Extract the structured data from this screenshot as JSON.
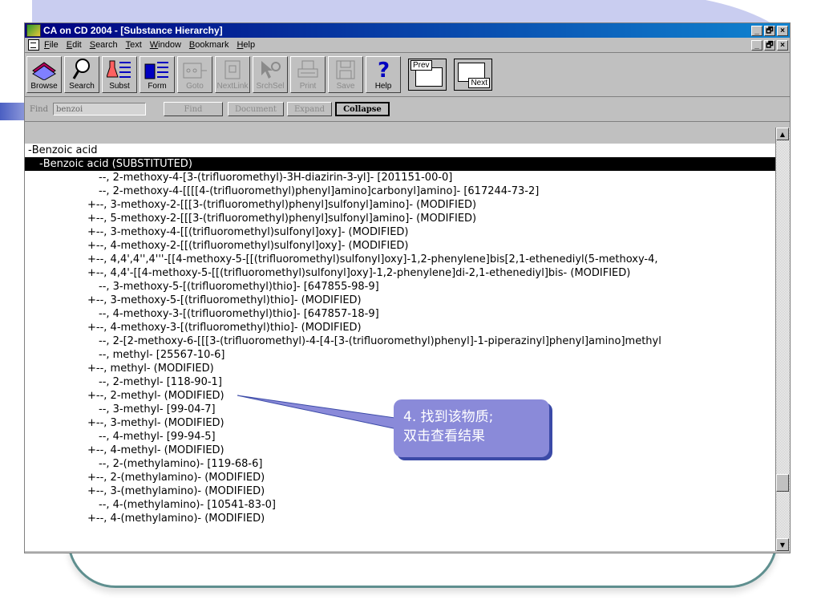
{
  "window": {
    "title": "CA on CD 2004 - [Substance Hierarchy]",
    "controls": [
      "_",
      "🗗",
      "×"
    ]
  },
  "menu": {
    "items": [
      {
        "key": "F",
        "rest": "ile"
      },
      {
        "key": "E",
        "rest": "dit"
      },
      {
        "key": "S",
        "rest": "earch"
      },
      {
        "key": "T",
        "rest": "ext"
      },
      {
        "key": "W",
        "rest": "indow"
      },
      {
        "key": "B",
        "rest": "ookmark"
      },
      {
        "key": "H",
        "rest": "elp"
      }
    ]
  },
  "toolbar": {
    "browse": "Browse",
    "search": "Search",
    "subst": "Subst",
    "form": "Form",
    "goto": "Goto",
    "nextlink": "NextLink",
    "srchsel": "SrchSel",
    "print": "Print",
    "save": "Save",
    "help": "Help",
    "prev": "Prev",
    "next": "Next"
  },
  "search": {
    "find_label": "Find",
    "find_value": "benzoi",
    "find_button": "Find",
    "document_button": "Document",
    "expand_button": "Expand",
    "collapse_button": "Collapse"
  },
  "tree": [
    {
      "lead": "- ",
      "text": "Benzoic acid",
      "sel": false,
      "indent": 4
    },
    {
      "lead": "- ",
      "text": "Benzoic acid (SUBSTITUTED)",
      "sel": true,
      "indent": 18
    },
    {
      "lead": "",
      "text": "--, 2-methoxy-4-[3-(trifluoromethyl)-3H-diazirin-3-yl]- [201151-00-0]",
      "sel": false,
      "indent": 92
    },
    {
      "lead": "",
      "text": "--, 2-methoxy-4-[[[[4-(trifluoromethyl)phenyl]amino]carbonyl]amino]- [617244-73-2]",
      "sel": false,
      "indent": 92
    },
    {
      "lead": "+ ",
      "text": "--, 3-methoxy-2-[[[3-(trifluoromethyl)phenyl]sulfonyl]amino]- (MODIFIED)",
      "sel": false,
      "indent": 78
    },
    {
      "lead": "+ ",
      "text": "--, 5-methoxy-2-[[[3-(trifluoromethyl)phenyl]sulfonyl]amino]- (MODIFIED)",
      "sel": false,
      "indent": 78
    },
    {
      "lead": "+ ",
      "text": "--, 3-methoxy-4-[[(trifluoromethyl)sulfonyl]oxy]- (MODIFIED)",
      "sel": false,
      "indent": 78
    },
    {
      "lead": "+ ",
      "text": "--, 4-methoxy-2-[[(trifluoromethyl)sulfonyl]oxy]- (MODIFIED)",
      "sel": false,
      "indent": 78
    },
    {
      "lead": "+ ",
      "text": "--, 4,4',4'',4'''-[[4-methoxy-5-[[(trifluoromethyl)sulfonyl]oxy]-1,2-phenylene]bis[2,1-ethenediyl(5-methoxy-4,",
      "sel": false,
      "indent": 78
    },
    {
      "lead": "+ ",
      "text": "--, 4,4'-[[4-methoxy-5-[[(trifluoromethyl)sulfonyl]oxy]-1,2-phenylene]di-2,1-ethenediyl]bis- (MODIFIED)",
      "sel": false,
      "indent": 78
    },
    {
      "lead": "",
      "text": "--, 3-methoxy-5-[(trifluoromethyl)thio]- [647855-98-9]",
      "sel": false,
      "indent": 92
    },
    {
      "lead": "+ ",
      "text": "--, 3-methoxy-5-[(trifluoromethyl)thio]- (MODIFIED)",
      "sel": false,
      "indent": 78
    },
    {
      "lead": "",
      "text": "--, 4-methoxy-3-[(trifluoromethyl)thio]- [647857-18-9]",
      "sel": false,
      "indent": 92
    },
    {
      "lead": "+ ",
      "text": "--, 4-methoxy-3-[(trifluoromethyl)thio]- (MODIFIED)",
      "sel": false,
      "indent": 78
    },
    {
      "lead": "",
      "text": "--, 2-[2-methoxy-6-[[[3-(trifluoromethyl)-4-[4-[3-(trifluoromethyl)phenyl]-1-piperazinyl]phenyl]amino]methyl",
      "sel": false,
      "indent": 92
    },
    {
      "lead": "",
      "text": "--, methyl- [25567-10-6]",
      "sel": false,
      "indent": 92
    },
    {
      "lead": "+ ",
      "text": "--, methyl- (MODIFIED)",
      "sel": false,
      "indent": 78
    },
    {
      "lead": "",
      "text": "--, 2-methyl- [118-90-1]",
      "sel": false,
      "indent": 92
    },
    {
      "lead": "+ ",
      "text": "--, 2-methyl- (MODIFIED)",
      "sel": false,
      "indent": 78
    },
    {
      "lead": "",
      "text": "--, 3-methyl- [99-04-7]",
      "sel": false,
      "indent": 92
    },
    {
      "lead": "+ ",
      "text": "--, 3-methyl- (MODIFIED)",
      "sel": false,
      "indent": 78
    },
    {
      "lead": "",
      "text": "--, 4-methyl- [99-94-5]",
      "sel": false,
      "indent": 92
    },
    {
      "lead": "+ ",
      "text": "--, 4-methyl- (MODIFIED)",
      "sel": false,
      "indent": 78
    },
    {
      "lead": "",
      "text": "--, 2-(methylamino)- [119-68-6]",
      "sel": false,
      "indent": 92
    },
    {
      "lead": "+ ",
      "text": "--, 2-(methylamino)- (MODIFIED)",
      "sel": false,
      "indent": 78
    },
    {
      "lead": "+ ",
      "text": "--, 3-(methylamino)- (MODIFIED)",
      "sel": false,
      "indent": 78
    },
    {
      "lead": "",
      "text": "--, 4-(methylamino)- [10541-83-0]",
      "sel": false,
      "indent": 92
    },
    {
      "lead": "+ ",
      "text": "--, 4-(methylamino)- (MODIFIED)",
      "sel": false,
      "indent": 78
    }
  ],
  "callout": {
    "line1": "4. 找到该物质;",
    "line2": "双击查看结果"
  },
  "colors": {
    "titlebar": "#000080",
    "callout": "#8a8ad9",
    "selection": "#000000"
  }
}
